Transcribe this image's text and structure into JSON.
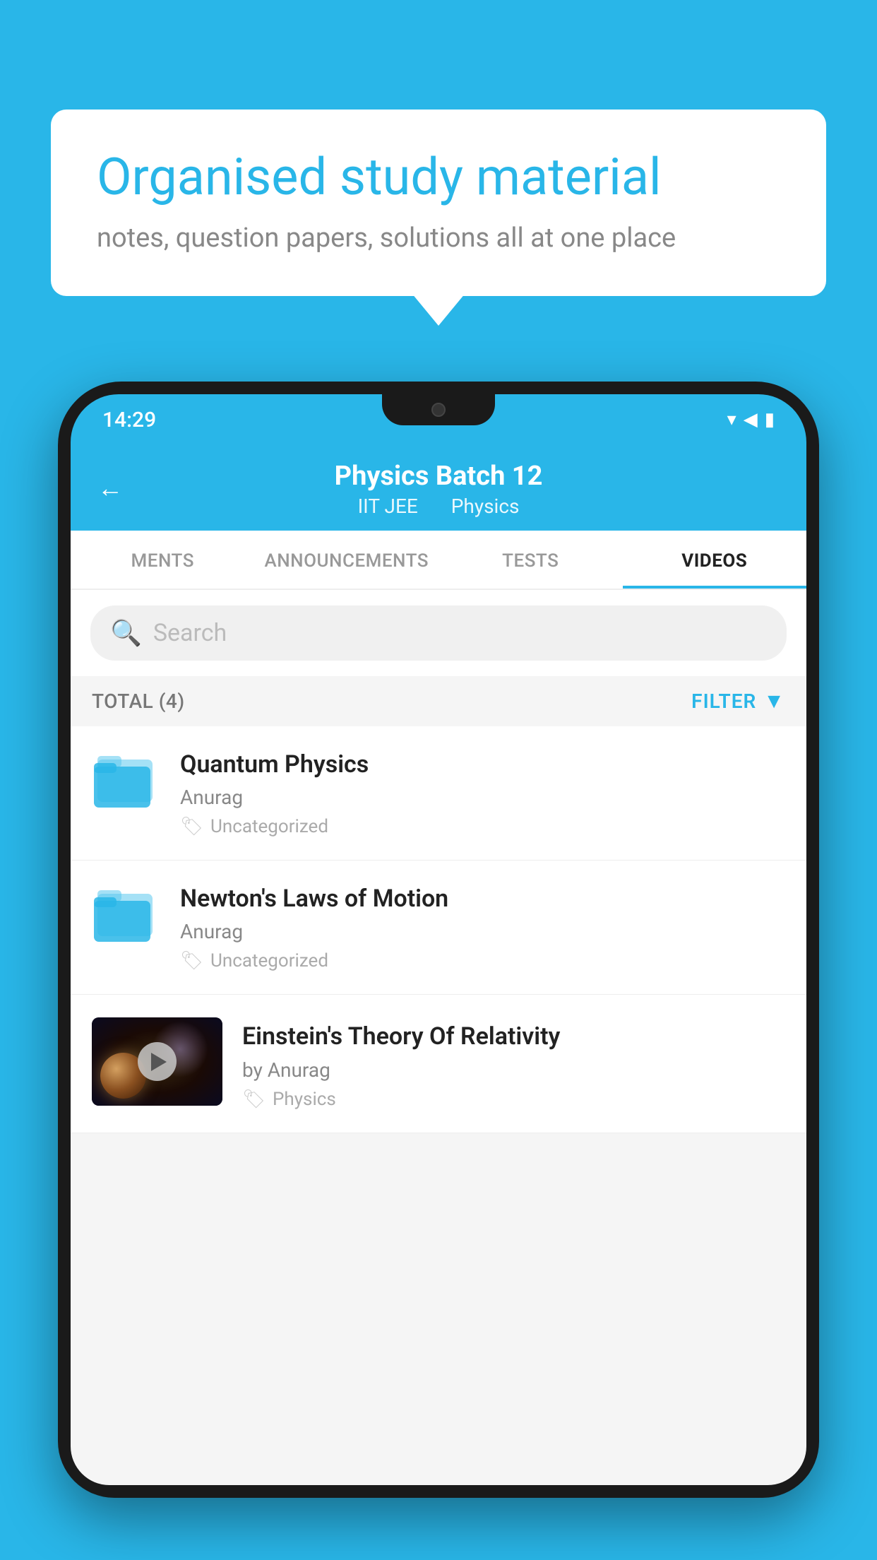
{
  "background": {
    "color": "#29B6E8"
  },
  "speech_bubble": {
    "title": "Organised study material",
    "subtitle": "notes, question papers, solutions all at one place"
  },
  "phone": {
    "status_bar": {
      "time": "14:29",
      "icons": [
        "wifi",
        "signal",
        "battery"
      ]
    },
    "header": {
      "back_label": "←",
      "title": "Physics Batch 12",
      "subtitle_parts": [
        "IIT JEE",
        "Physics"
      ]
    },
    "tabs": [
      {
        "label": "MENTS",
        "active": false
      },
      {
        "label": "ANNOUNCEMENTS",
        "active": false
      },
      {
        "label": "TESTS",
        "active": false
      },
      {
        "label": "VIDEOS",
        "active": true
      }
    ],
    "search": {
      "placeholder": "Search"
    },
    "filter_bar": {
      "total_label": "TOTAL (4)",
      "filter_label": "FILTER"
    },
    "videos": [
      {
        "id": 1,
        "title": "Quantum Physics",
        "author": "Anurag",
        "tag": "Uncategorized",
        "type": "folder"
      },
      {
        "id": 2,
        "title": "Newton's Laws of Motion",
        "author": "Anurag",
        "tag": "Uncategorized",
        "type": "folder"
      },
      {
        "id": 3,
        "title": "Einstein's Theory Of Relativity",
        "author": "by Anurag",
        "tag": "Physics",
        "type": "video"
      }
    ]
  }
}
